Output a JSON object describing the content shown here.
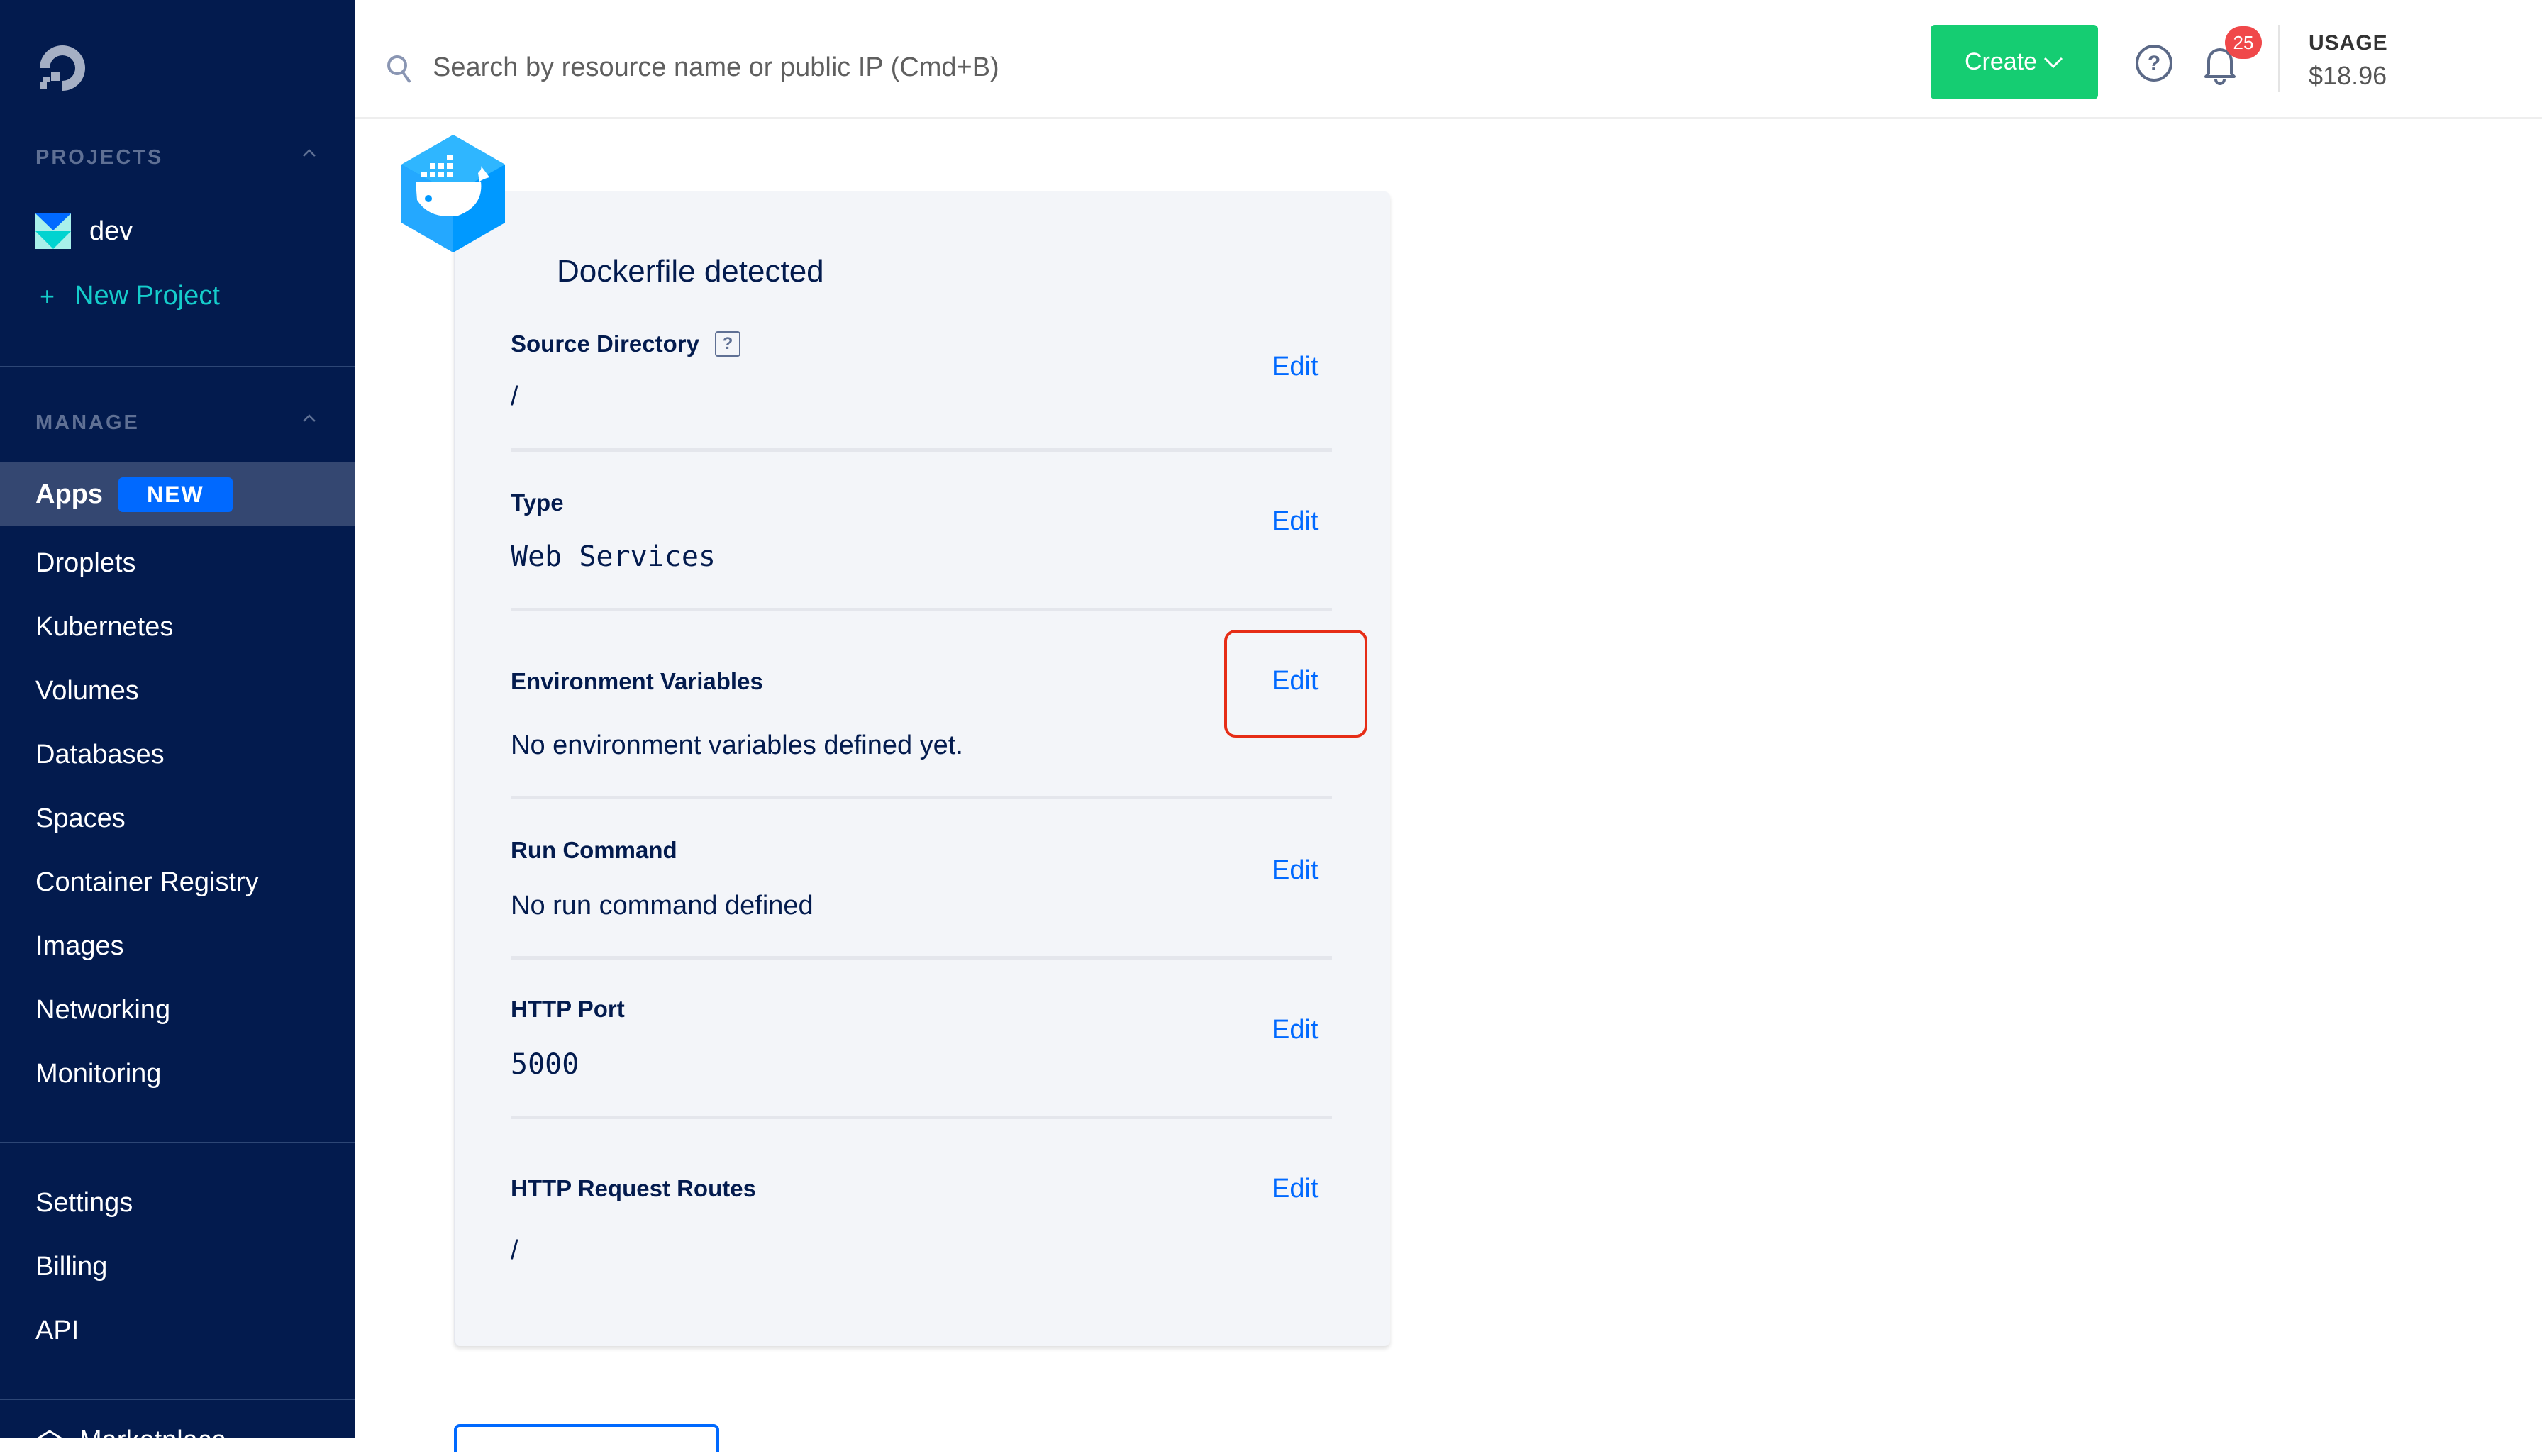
{
  "sidebar": {
    "projects_header": "PROJECTS",
    "projects": [
      {
        "label": "dev"
      }
    ],
    "new_project_label": "New Project",
    "manage_header": "MANAGE",
    "manage_items": [
      {
        "label": "Apps",
        "badge": "NEW",
        "active": true
      },
      {
        "label": "Droplets"
      },
      {
        "label": "Kubernetes"
      },
      {
        "label": "Volumes"
      },
      {
        "label": "Databases"
      },
      {
        "label": "Spaces"
      },
      {
        "label": "Container Registry"
      },
      {
        "label": "Images"
      },
      {
        "label": "Networking"
      },
      {
        "label": "Monitoring"
      }
    ],
    "account_items": [
      {
        "label": "Settings"
      },
      {
        "label": "Billing"
      },
      {
        "label": "API"
      }
    ],
    "marketplace_label": "Marketplace"
  },
  "topbar": {
    "search_placeholder": "Search by resource name or public IP (Cmd+B)",
    "create_label": "Create",
    "notification_count": "25",
    "usage_label": "USAGE",
    "usage_value": "$18.96"
  },
  "card": {
    "title": "Dockerfile detected",
    "fields": [
      {
        "label": "Source Directory",
        "value": "/",
        "edit": "Edit",
        "has_help": true
      },
      {
        "label": "Type",
        "value": "Web Services",
        "edit": "Edit"
      },
      {
        "label": "Environment Variables",
        "value": "No environment variables defined yet.",
        "edit": "Edit",
        "highlighted": true
      },
      {
        "label": "Run Command",
        "value": "No run command defined",
        "edit": "Edit"
      },
      {
        "label": "HTTP Port",
        "value": "5000",
        "edit": "Edit"
      },
      {
        "label": "HTTP Request Routes",
        "value": "/",
        "edit": "Edit"
      }
    ],
    "help_glyph": "?"
  },
  "colors": {
    "sidebar_bg": "#031b4e",
    "accent_blue": "#0069ff",
    "create_green": "#15cd72",
    "notification_red": "#f0484a",
    "highlight_red": "#e62d17",
    "teal": "#15cdcb"
  }
}
